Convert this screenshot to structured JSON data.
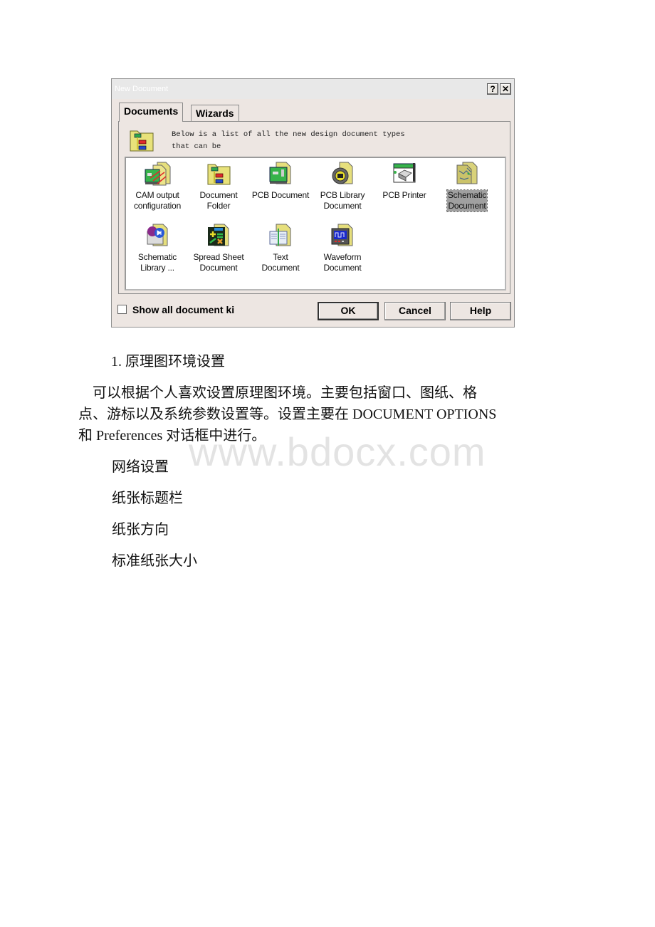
{
  "dialog": {
    "title": "New Document",
    "help_button": "?",
    "close_button": "✕",
    "tabs": [
      {
        "label": "Documents",
        "active": true
      },
      {
        "label": "Wizards",
        "active": false
      }
    ],
    "description_line1": "Below is a list of all the new design document types",
    "description_line2": "that can be",
    "items": [
      {
        "line1": "CAM output",
        "line2": "configuration",
        "icon": "cam-output-icon",
        "selected": false
      },
      {
        "line1": "Document",
        "line2": "Folder",
        "icon": "document-folder-icon",
        "selected": false
      },
      {
        "line1": "PCB Document",
        "line2": "",
        "icon": "pcb-document-icon",
        "selected": false
      },
      {
        "line1": "PCB Library",
        "line2": "Document",
        "icon": "pcb-library-icon",
        "selected": false
      },
      {
        "line1": "PCB Printer",
        "line2": "",
        "icon": "pcb-printer-icon",
        "selected": false
      },
      {
        "line1": "Schematic",
        "line2": "Document",
        "icon": "schematic-document-icon",
        "selected": true
      },
      {
        "line1": "Schematic",
        "line2": "Library ...",
        "icon": "schematic-library-icon",
        "selected": false
      },
      {
        "line1": "Spread Sheet",
        "line2": "Document",
        "icon": "spreadsheet-icon",
        "selected": false
      },
      {
        "line1": "Text",
        "line2": "Document",
        "icon": "text-document-icon",
        "selected": false
      },
      {
        "line1": "Waveform",
        "line2": "Document",
        "icon": "waveform-icon",
        "selected": false
      }
    ],
    "show_all_label": "Show all document ki",
    "show_all_checked": false,
    "ok_label": "OK",
    "cancel_label": "Cancel",
    "help_label": "Help"
  },
  "document": {
    "heading": "1. 原理图环境设置",
    "paragraph_lines": [
      "　可以根据个人喜欢设置原理图环境。主要包括窗口、图纸、格",
      "点、游标以及系统参数设置等。设置主要在 DOCUMENT OPTIONS",
      "和 Preferences 对话框中进行。"
    ],
    "items": [
      "网络设置",
      "纸张标题栏",
      "纸张方向",
      "标准纸张大小"
    ],
    "watermark": "www.bdocx.com"
  }
}
